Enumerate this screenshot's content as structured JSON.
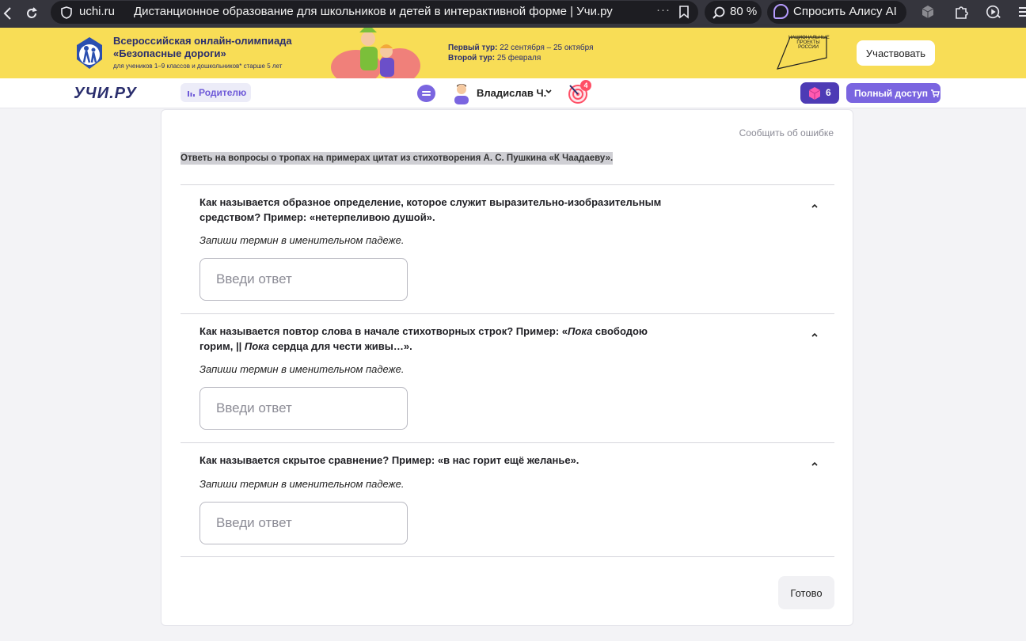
{
  "browser": {
    "host": "uchi.ru",
    "tab_title": "Дистанционное образование для школьников и детей в интерактивной форме | Учи.ру",
    "dots": "···",
    "zoom": "80 %",
    "alice_label": "Спросить Алису AI"
  },
  "banner": {
    "title_line1": "Всероссийская онлайн-олимпиада",
    "title_line2": "«Безопасные дороги»",
    "subtitle": "для учеников 1–9 классов и дошкольников* старше 5 лет",
    "tour1_label": "Первый тур:",
    "tour1_dates": "22 сентября – 25 октября",
    "tour2_label": "Второй тур:",
    "tour2_dates": "25 февраля",
    "np_text": "НАЦИОНАЛЬНЫЕ ПРОЕКТЫ РОССИИ",
    "join_label": "Участвовать"
  },
  "header": {
    "logo": "УЧИ.РУ",
    "parent_label": "Родителю",
    "user_name": "Владислав Ч.",
    "notif_count": "4",
    "gems_count": "6",
    "full_access_label": "Полный доступ"
  },
  "task": {
    "report_label": "Сообщить об ошибке",
    "intro": "Ответь на вопросы о тропах на примерах цитат из стихотворения А. С. Пушкина «К Чаадаеву».",
    "questions": [
      {
        "text_a": "Как называется образное определение, которое служит выразительно-изобразительным средством? Пример: «нетерпеливою душой».",
        "hint": "Запиши термин в именительном падеже.",
        "placeholder": "Введи ответ",
        "value": ""
      },
      {
        "text_a": "Как называется повтор слова в начале стихотворных строк? Пример: «",
        "em1": "Пока",
        "text_b": " свободою горим, || ",
        "em2": "Пока",
        "text_c": " сердца для чести живы…».",
        "hint": "Запиши термин в именительном падеже.",
        "placeholder": "Введи ответ",
        "value": ""
      },
      {
        "text_a": "Как называется скрытое сравнение? Пример: «в нас горит ещё желанье».",
        "hint": "Запиши термин в именительном падеже.",
        "placeholder": "Введи ответ",
        "value": ""
      }
    ],
    "done_label": "Готово"
  },
  "colors": {
    "banner_bg": "#f8dd56",
    "accent": "#7a65e0",
    "brand_dark": "#2a2e6d"
  }
}
